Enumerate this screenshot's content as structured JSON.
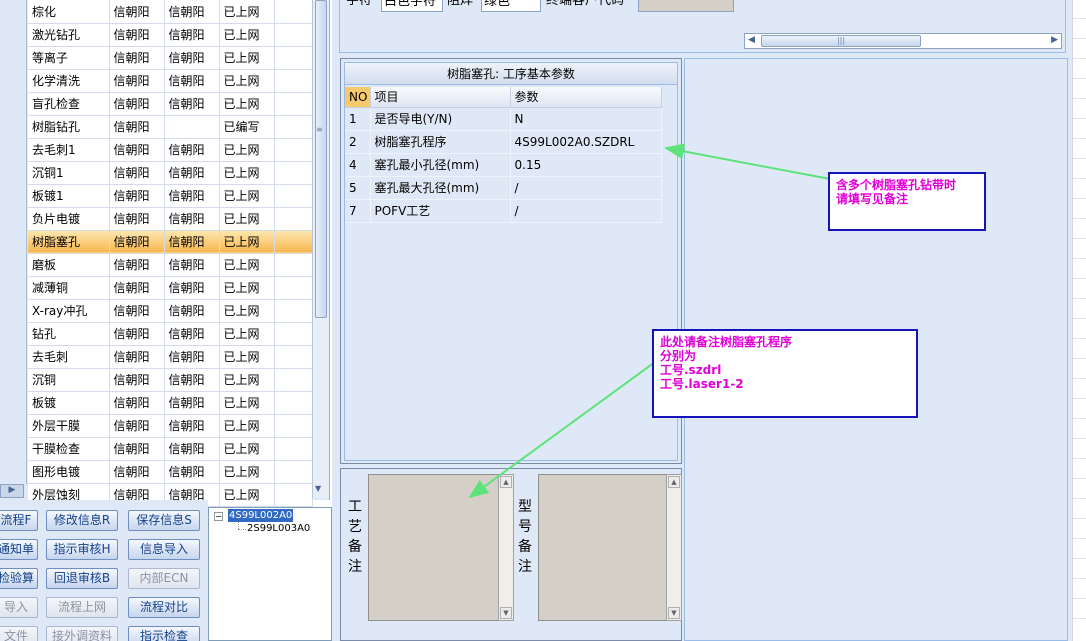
{
  "process_list": {
    "rows": [
      {
        "name": "棕化",
        "c2": "信朝阳",
        "c3": "信朝阳",
        "status": "已上网"
      },
      {
        "name": "激光钻孔",
        "c2": "信朝阳",
        "c3": "信朝阳",
        "status": "已上网"
      },
      {
        "name": "等离子",
        "c2": "信朝阳",
        "c3": "信朝阳",
        "status": "已上网"
      },
      {
        "name": "化学清洗",
        "c2": "信朝阳",
        "c3": "信朝阳",
        "status": "已上网"
      },
      {
        "name": "盲孔检查",
        "c2": "信朝阳",
        "c3": "信朝阳",
        "status": "已上网"
      },
      {
        "name": "树脂钻孔",
        "c2": "信朝阳",
        "c3": "",
        "status": "已编写"
      },
      {
        "name": "去毛刺1",
        "c2": "信朝阳",
        "c3": "信朝阳",
        "status": "已上网"
      },
      {
        "name": "沉铜1",
        "c2": "信朝阳",
        "c3": "信朝阳",
        "status": "已上网"
      },
      {
        "name": "板镀1",
        "c2": "信朝阳",
        "c3": "信朝阳",
        "status": "已上网"
      },
      {
        "name": "负片电镀",
        "c2": "信朝阳",
        "c3": "信朝阳",
        "status": "已上网"
      },
      {
        "name": "树脂塞孔",
        "c2": "信朝阳",
        "c3": "信朝阳",
        "status": "已上网"
      },
      {
        "name": "磨板",
        "c2": "信朝阳",
        "c3": "信朝阳",
        "status": "已上网"
      },
      {
        "name": "减薄铜",
        "c2": "信朝阳",
        "c3": "信朝阳",
        "status": "已上网"
      },
      {
        "name": "X-ray冲孔",
        "c2": "信朝阳",
        "c3": "信朝阳",
        "status": "已上网"
      },
      {
        "name": "钻孔",
        "c2": "信朝阳",
        "c3": "信朝阳",
        "status": "已上网"
      },
      {
        "name": "去毛刺",
        "c2": "信朝阳",
        "c3": "信朝阳",
        "status": "已上网"
      },
      {
        "name": "沉铜",
        "c2": "信朝阳",
        "c3": "信朝阳",
        "status": "已上网"
      },
      {
        "name": "板镀",
        "c2": "信朝阳",
        "c3": "信朝阳",
        "status": "已上网"
      },
      {
        "name": "外层干膜",
        "c2": "信朝阳",
        "c3": "信朝阳",
        "status": "已上网"
      },
      {
        "name": "干膜检查",
        "c2": "信朝阳",
        "c3": "信朝阳",
        "status": "已上网"
      },
      {
        "name": "图形电镀",
        "c2": "信朝阳",
        "c3": "信朝阳",
        "status": "已上网"
      },
      {
        "name": "外层蚀刻",
        "c2": "信朝阳",
        "c3": "信朝阳",
        "status": "已上网"
      }
    ]
  },
  "buttons": {
    "flow": "流程F",
    "modify_info": "修改信息R",
    "save_info": "保存信息S",
    "notice": "通知单",
    "instruction_review": "指示审核H",
    "info_import": "信息导入",
    "check": "检验算",
    "rollback_review": "回退审核B",
    "internal_ecn": "内部ECN",
    "import": "导入",
    "flow_online": "流程上网",
    "flow_compare": "流程对比",
    "file": "文件",
    "external_data": "接外调资料",
    "instruction_check": "指示检查"
  },
  "tree": {
    "node1": "4S99L002A0",
    "node2": "2S99L003A0"
  },
  "top_fields": {
    "f1": "字符",
    "f2": "白色字符",
    "f3": "阻焊",
    "f4": "绿色",
    "f5": "终端客户代码",
    "f6": ""
  },
  "params": {
    "title": "树脂塞孔: 工序基本参数",
    "headers": {
      "no": "NO",
      "item": "项目",
      "param": "参数"
    },
    "rows": [
      {
        "no": "1",
        "item": "是否导电(Y/N)",
        "value": "N"
      },
      {
        "no": "2",
        "item": "树脂塞孔程序",
        "value": "4S99L002A0.SZDRL"
      },
      {
        "no": "4",
        "item": "塞孔最小孔径(mm)",
        "value": "0.15"
      },
      {
        "no": "5",
        "item": "塞孔最大孔径(mm)",
        "value": "/"
      },
      {
        "no": "7",
        "item": "POFV工艺",
        "value": "/"
      }
    ]
  },
  "notes": {
    "process_label": "工艺备注",
    "model_label": "型号备注",
    "process_value": "",
    "model_value": ""
  },
  "annotations": {
    "top_lines": [
      "含多个树脂塞孔钻带时",
      "请填写见备注"
    ],
    "bottom_lines": [
      "此处请备注树脂塞孔程序",
      "分别为",
      "工号.szdrl",
      "工号.laser1-2"
    ],
    "arrow_color": "#5ee37a"
  }
}
